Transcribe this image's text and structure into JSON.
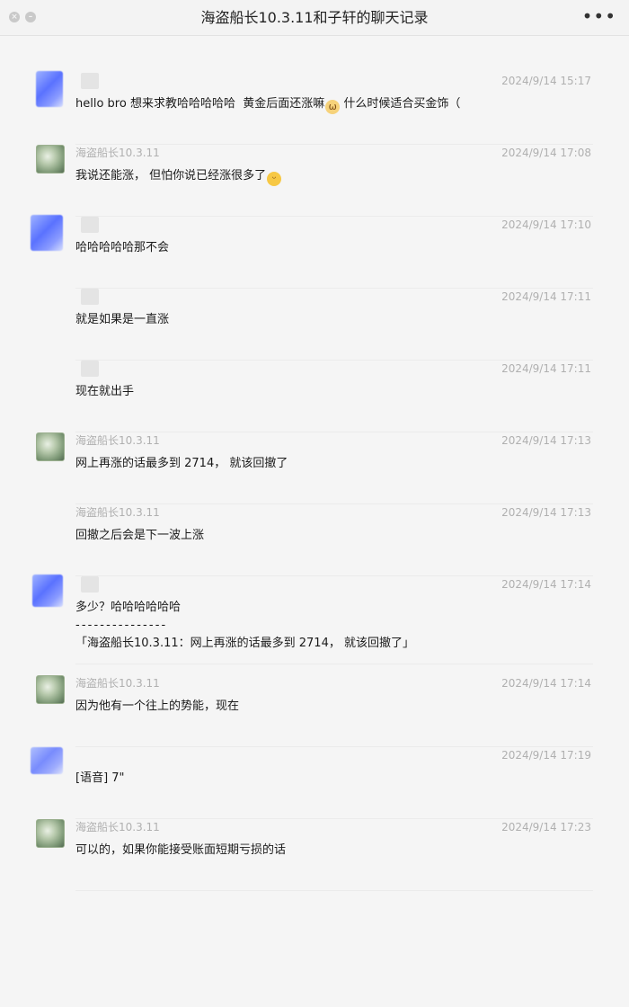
{
  "window": {
    "title": "海盗船长10.3.11和子轩的聊天记录",
    "more_label": "•••",
    "controls": {
      "close": "×",
      "minimize": "–"
    }
  },
  "messages": [
    {
      "sender": "",
      "avatar": "blur",
      "time": "2024/9/14 15:17",
      "text": "hello bro 想来求教哈哈哈哈哈  黄金后面还涨嘛",
      "emoji": "cat",
      "text_after": " 什么时候适合买金饰（"
    },
    {
      "sender": "海盗船长10.3.11",
      "avatar": "landscape",
      "time": "2024/9/14 17:08",
      "text": "我说还能涨， 但怕你说已经涨很多了",
      "emoji": "laugh",
      "text_after": ""
    },
    {
      "sender": "",
      "avatar": "blur",
      "time": "2024/9/14 17:10",
      "text": "哈哈哈哈哈那不会"
    },
    {
      "sender": "",
      "avatar": "none",
      "time": "2024/9/14 17:11",
      "text": "就是如果是一直涨"
    },
    {
      "sender": "",
      "avatar": "none",
      "time": "2024/9/14 17:11",
      "text": "现在就出手"
    },
    {
      "sender": "海盗船长10.3.11",
      "avatar": "landscape",
      "time": "2024/9/14 17:13",
      "text": "网上再涨的话最多到 2714， 就该回撤了"
    },
    {
      "sender": "海盗船长10.3.11",
      "avatar": "none",
      "time": "2024/9/14 17:13",
      "text": "回撤之后会是下一波上涨"
    },
    {
      "sender": "",
      "avatar": "blur",
      "time": "2024/9/14 17:14",
      "text": "多少？哈哈哈哈哈哈",
      "text_line2": "- - - - - - - - - - - - - - -",
      "text_line3": "「海盗船长10.3.11：网上再涨的话最多到 2714， 就该回撤了」"
    },
    {
      "sender": "海盗船长10.3.11",
      "avatar": "landscape",
      "time": "2024/9/14 17:14",
      "text": "因为他有一个往上的势能，现在"
    },
    {
      "sender": "",
      "avatar": "blur",
      "time": "2024/9/14 17:19",
      "text": "[语音] 7\""
    },
    {
      "sender": "海盗船长10.3.11",
      "avatar": "landscape",
      "time": "2024/9/14 17:23",
      "text": "可以的，如果你能接受账面短期亏损的话"
    }
  ]
}
